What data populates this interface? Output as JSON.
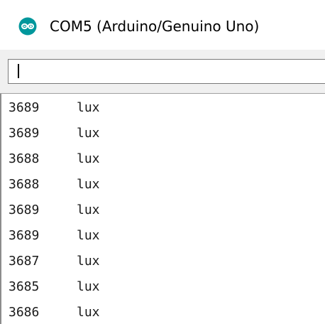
{
  "window": {
    "title": "COM5 (Arduino/Genuino Uno)",
    "icon": "arduino-logo-icon",
    "accent_color": "#00979c"
  },
  "send_bar": {
    "input_value": ""
  },
  "serial_output": {
    "lines": [
      {
        "value": "3689",
        "unit": "lux"
      },
      {
        "value": "3689",
        "unit": "lux"
      },
      {
        "value": "3688",
        "unit": "lux"
      },
      {
        "value": "3688",
        "unit": "lux"
      },
      {
        "value": "3689",
        "unit": "lux"
      },
      {
        "value": "3689",
        "unit": "lux"
      },
      {
        "value": "3687",
        "unit": "lux"
      },
      {
        "value": "3685",
        "unit": "lux"
      },
      {
        "value": "3686",
        "unit": "lux"
      }
    ]
  }
}
